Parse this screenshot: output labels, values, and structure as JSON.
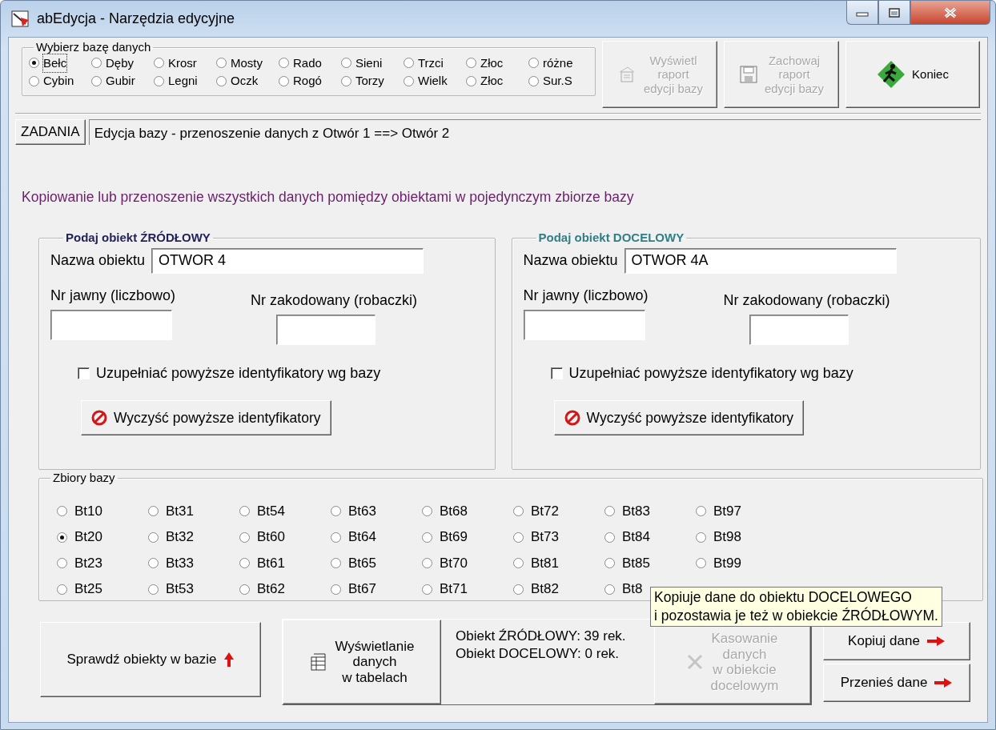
{
  "window": {
    "title": "abEdycja - Narzędzia edycyjne"
  },
  "database_group": {
    "legend": "Wybierz bazę danych",
    "rows": [
      [
        {
          "label": "Bełc",
          "selected": true
        },
        {
          "label": "Dęby",
          "selected": false
        },
        {
          "label": "Krosr",
          "selected": false
        },
        {
          "label": "Mosty",
          "selected": false
        },
        {
          "label": "Rado",
          "selected": false
        },
        {
          "label": "Sieni",
          "selected": false
        },
        {
          "label": "Trzci",
          "selected": false
        },
        {
          "label": "Złoc",
          "selected": false
        },
        {
          "label": "różne",
          "selected": false
        }
      ],
      [
        {
          "label": "Cybin",
          "selected": false
        },
        {
          "label": "Gubir",
          "selected": false
        },
        {
          "label": "Legni",
          "selected": false
        },
        {
          "label": "Oczk",
          "selected": false
        },
        {
          "label": "Rogó",
          "selected": false
        },
        {
          "label": "Torzy",
          "selected": false
        },
        {
          "label": "Wielk",
          "selected": false
        },
        {
          "label": "Złoc",
          "selected": false
        },
        {
          "label": "Sur.S",
          "selected": false
        }
      ]
    ]
  },
  "toolbar_buttons": [
    {
      "kind": "report",
      "lines": [
        "Wyświetl",
        "raport",
        "edycji bazy"
      ],
      "disabled": true
    },
    {
      "kind": "save",
      "lines": [
        "Zachowaj",
        "raport",
        "edycji bazy"
      ],
      "disabled": true
    },
    {
      "kind": "exit",
      "lines": [
        "Koniec"
      ],
      "disabled": false
    }
  ],
  "tasks_button": "ZADANIA",
  "task_title": "Edycja bazy - przenoszenie danych z Otwór 1 ==> Otwór 2",
  "description": "Kopiowanie lub przenoszenie wszystkich danych pomiędzy obiektami w pojedynczym zbiorze bazy",
  "objects": [
    {
      "legend": "Podaj obiekt ŹRÓDŁOWY",
      "color": "#23235a",
      "name_label": "Nazwa obiektu",
      "name_value": "OTWOR 4",
      "public_label": "Nr jawny (liczbowo)",
      "coded_label": "Nr zakodowany (robaczki)",
      "fill_checkbox": {
        "label": "Uzupełniać powyższe identyfikatory wg bazy",
        "checked": false
      },
      "clear_button": "Wyczyść powyższe identyfikatory"
    },
    {
      "legend": "Podaj obiekt DOCELOWY",
      "color": "#2f7f86",
      "name_label": "Nazwa obiektu",
      "name_value": "OTWOR 4A",
      "public_label": "Nr jawny (liczbowo)",
      "coded_label": "Nr zakodowany (robaczki)",
      "fill_checkbox": {
        "label": "Uzupełniać powyższe identyfikatory wg bazy",
        "checked": false
      },
      "clear_button": "Wyczyść powyższe identyfikatory"
    }
  ],
  "sets": {
    "legend": "Zbiory bazy",
    "rows": [
      [
        {
          "label": "Bt10",
          "selected": false
        },
        {
          "label": "Bt31",
          "selected": false
        },
        {
          "label": "Bt54",
          "selected": false
        },
        {
          "label": "Bt63",
          "selected": false
        },
        {
          "label": "Bt68",
          "selected": false
        },
        {
          "label": "Bt72",
          "selected": false
        },
        {
          "label": "Bt83",
          "selected": false
        },
        {
          "label": "Bt97",
          "selected": false
        }
      ],
      [
        {
          "label": "Bt20",
          "selected": true
        },
        {
          "label": "Bt32",
          "selected": false
        },
        {
          "label": "Bt60",
          "selected": false
        },
        {
          "label": "Bt64",
          "selected": false
        },
        {
          "label": "Bt69",
          "selected": false
        },
        {
          "label": "Bt73",
          "selected": false
        },
        {
          "label": "Bt84",
          "selected": false
        },
        {
          "label": "Bt98",
          "selected": false
        }
      ],
      [
        {
          "label": "Bt23",
          "selected": false
        },
        {
          "label": "Bt33",
          "selected": false
        },
        {
          "label": "Bt61",
          "selected": false
        },
        {
          "label": "Bt65",
          "selected": false
        },
        {
          "label": "Bt70",
          "selected": false
        },
        {
          "label": "Bt81",
          "selected": false
        },
        {
          "label": "Bt85",
          "selected": false
        },
        {
          "label": "Bt99",
          "selected": false
        }
      ],
      [
        {
          "label": "Bt25",
          "selected": false
        },
        {
          "label": "Bt53",
          "selected": false
        },
        {
          "label": "Bt62",
          "selected": false
        },
        {
          "label": "Bt67",
          "selected": false
        },
        {
          "label": "Bt71",
          "selected": false
        },
        {
          "label": "Bt82",
          "selected": false
        },
        {
          "label": "Bt8",
          "selected": false
        }
      ]
    ]
  },
  "check_button": "Sprawdź obiekty w bazie",
  "show_button": {
    "lines": [
      "Wyświetlanie",
      "danych",
      "w tabelach"
    ]
  },
  "counts": [
    "Obiekt ŹRÓDŁOWY: 39 rek.",
    "Obiekt DOCELOWY: 0 rek."
  ],
  "delete_button": {
    "lines": [
      "Kasowanie",
      "danych",
      "w obiekcie",
      "docelowym"
    ],
    "disabled": true
  },
  "copy_button": "Kopiuj dane",
  "move_button": "Przenieś dane",
  "tooltip": {
    "lines": [
      "Kopiuje dane do obiektu DOCELOWEGO",
      "i pozostawia je też w obiekcie ŹRÓDŁOWYM."
    ]
  }
}
